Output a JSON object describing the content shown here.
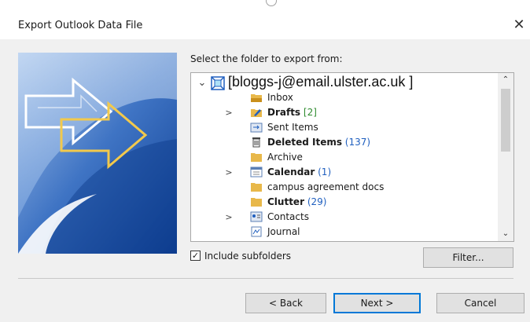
{
  "window": {
    "title": "Export Outlook Data File",
    "close_glyph": "✕"
  },
  "prompt": "Select the folder to export from:",
  "tree": {
    "root": {
      "label": "[bloggs-j@email.ulster.ac.uk ]",
      "expander": "⌄"
    },
    "items": [
      {
        "label": "Inbox",
        "bold": false,
        "count": "",
        "expander": "",
        "icon": "inbox-folder-icon"
      },
      {
        "label": "Drafts",
        "bold": true,
        "count": "[2]",
        "expander": ">",
        "icon": "drafts-folder-icon"
      },
      {
        "label": "Sent Items",
        "bold": false,
        "count": "",
        "expander": "",
        "icon": "sent-items-icon"
      },
      {
        "label": "Deleted Items",
        "bold": true,
        "count": "(137)",
        "expander": "",
        "icon": "trash-icon"
      },
      {
        "label": "Archive",
        "bold": false,
        "count": "",
        "expander": "",
        "icon": "folder-icon"
      },
      {
        "label": "Calendar",
        "bold": true,
        "count": "(1)",
        "expander": ">",
        "icon": "calendar-icon"
      },
      {
        "label": "campus agreement docs",
        "bold": false,
        "count": "",
        "expander": "",
        "icon": "folder-icon"
      },
      {
        "label": "Clutter",
        "bold": true,
        "count": "(29)",
        "expander": "",
        "icon": "folder-icon"
      },
      {
        "label": "Contacts",
        "bold": false,
        "count": "",
        "expander": ">",
        "icon": "contacts-icon"
      },
      {
        "label": "Journal",
        "bold": false,
        "count": "",
        "expander": "",
        "icon": "journal-icon"
      }
    ]
  },
  "scrollbar": {
    "up": "⌃",
    "down": "⌄"
  },
  "options": {
    "include_subfolders_label": "Include subfolders",
    "include_subfolders_checked": true,
    "check_glyph": "✓"
  },
  "buttons": {
    "filter": "Filter...",
    "back": "< Back",
    "next": "Next >",
    "cancel": "Cancel"
  },
  "colors": {
    "accent": "#0078d7",
    "count": "#1f5fbf",
    "folder": "#e8b84a"
  }
}
